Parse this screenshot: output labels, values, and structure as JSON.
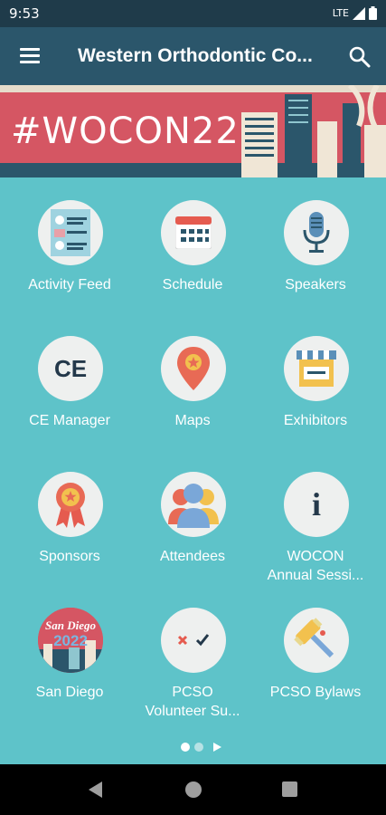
{
  "status": {
    "time": "9:53",
    "network": "LTE"
  },
  "app_bar": {
    "title": "Western Orthodontic Co..."
  },
  "banner": {
    "hashtag": "#WOCON22"
  },
  "tiles": [
    {
      "label": "Activity Feed",
      "icon": "activity-feed-icon"
    },
    {
      "label": "Schedule",
      "icon": "calendar-icon"
    },
    {
      "label": "Speakers",
      "icon": "microphone-icon"
    },
    {
      "label": "CE Manager",
      "icon": "ce-icon",
      "icon_text": "CE"
    },
    {
      "label": "Maps",
      "icon": "map-pin-icon"
    },
    {
      "label": "Exhibitors",
      "icon": "booth-icon"
    },
    {
      "label": "Sponsors",
      "icon": "ribbon-icon"
    },
    {
      "label": "Attendees",
      "icon": "people-icon"
    },
    {
      "label": "WOCON\nAnnual Sessi...",
      "icon": "info-icon",
      "icon_text": "i"
    },
    {
      "label": "San Diego",
      "icon": "san-diego-icon",
      "icon_text_1": "San Diego",
      "icon_text_2": "2022"
    },
    {
      "label": "PCSO\nVolunteer Su...",
      "icon": "checkbox-icon"
    },
    {
      "label": "PCSO Bylaws",
      "icon": "gavel-icon"
    }
  ],
  "pager": {
    "current_page": 1,
    "total_pages": 2
  },
  "colors": {
    "status_bar": "#1f3b4a",
    "app_bar": "#2b566b",
    "banner": "#d55663",
    "grid_background": "#5ec3c9"
  }
}
